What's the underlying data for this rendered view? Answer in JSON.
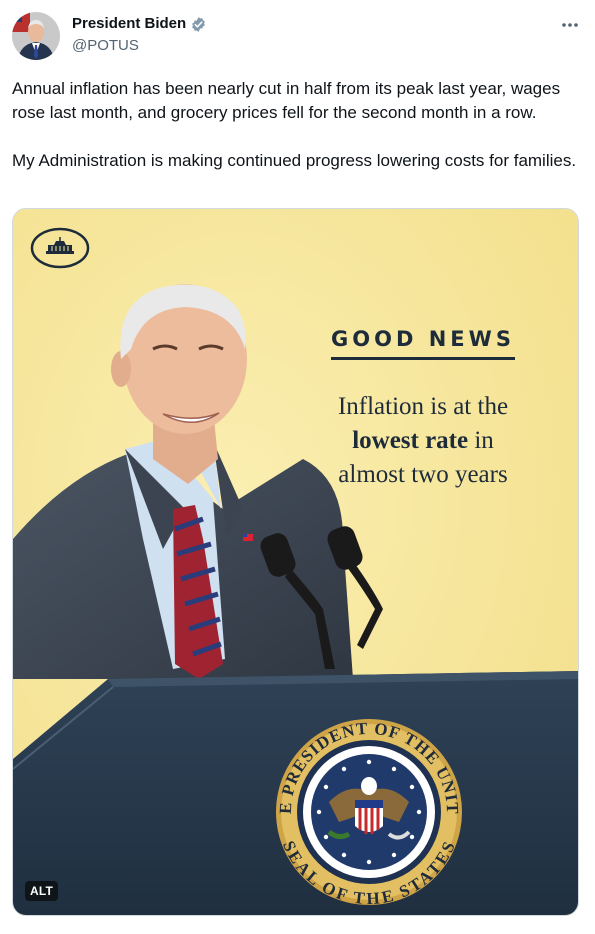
{
  "author": {
    "display_name": "President Biden",
    "handle": "@POTUS"
  },
  "tweet": {
    "paragraph_1": "Annual inflation has been nearly cut in half from its peak last year, wages rose last month, and grocery prices fell for the second month in a row.",
    "paragraph_2": "My Administration is making continued progress lowering costs for families."
  },
  "media": {
    "headline_top": "GOOD NEWS",
    "line_1": "Inflation is at the",
    "line_2_bold": "lowest rate",
    "line_2_rest": " in",
    "line_3": "almost two years",
    "seal_top_text": "THE PRESIDENT OF THE UNITED",
    "seal_bottom_text": "SEAL OF THE STATES",
    "alt_badge": "ALT"
  },
  "colors": {
    "background_yellow": "#f7e79d",
    "navy": "#1d2b3a",
    "verified_badge": "#829aab"
  },
  "icons": {
    "verified": "verified-badge-icon",
    "more": "more-dots-icon",
    "white_house": "white-house-logo-icon"
  }
}
